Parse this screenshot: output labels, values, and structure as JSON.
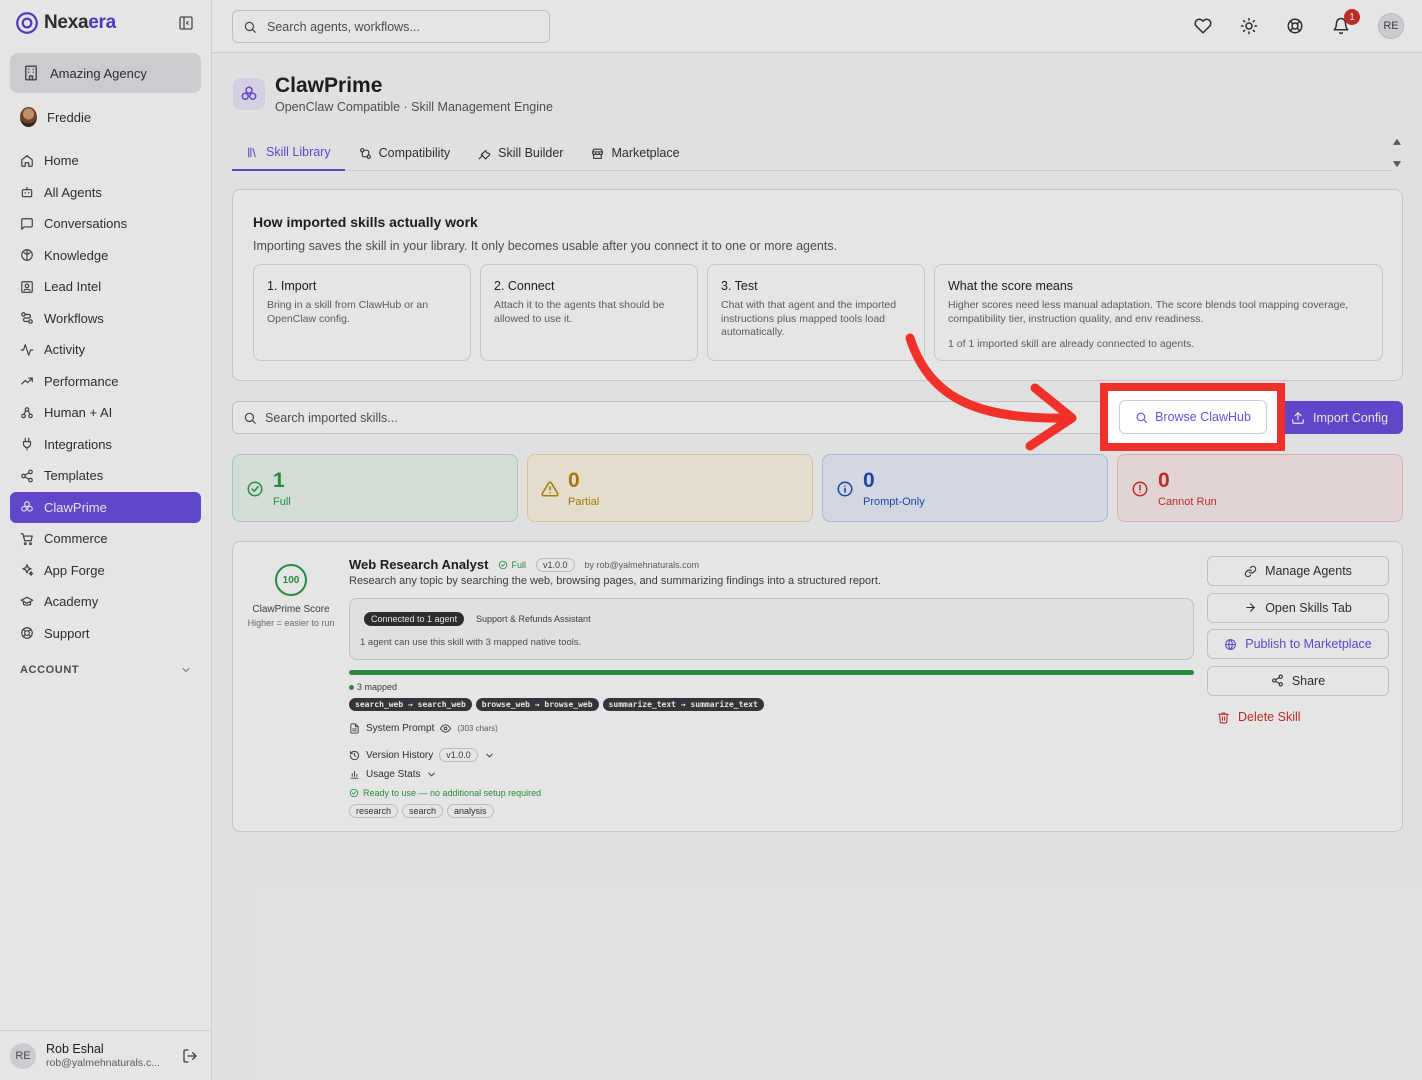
{
  "brand": {
    "name_prefix": "Nexa",
    "name_suffix": "era"
  },
  "agency": {
    "label": "Amazing Agency"
  },
  "user": {
    "name": "Freddie"
  },
  "nav": [
    {
      "label": "Home",
      "icon": "home-icon"
    },
    {
      "label": "All Agents",
      "icon": "bot-icon"
    },
    {
      "label": "Conversations",
      "icon": "message-icon"
    },
    {
      "label": "Knowledge",
      "icon": "brain-icon"
    },
    {
      "label": "Lead Intel",
      "icon": "contact-icon"
    },
    {
      "label": "Workflows",
      "icon": "workflow-icon"
    },
    {
      "label": "Activity",
      "icon": "activity-icon"
    },
    {
      "label": "Performance",
      "icon": "trend-icon"
    },
    {
      "label": "Human + AI",
      "icon": "users-icon"
    },
    {
      "label": "Integrations",
      "icon": "plug-icon"
    },
    {
      "label": "Templates",
      "icon": "share-icon"
    },
    {
      "label": "ClawPrime",
      "icon": "clawprime-icon",
      "active": true
    },
    {
      "label": "Commerce",
      "icon": "cart-icon"
    },
    {
      "label": "App Forge",
      "icon": "sparkle-icon"
    },
    {
      "label": "Academy",
      "icon": "graduation-icon"
    },
    {
      "label": "Support",
      "icon": "lifebuoy-icon"
    }
  ],
  "account_label": "ACCOUNT",
  "footer_user": {
    "initials": "RE",
    "name": "Rob Eshal",
    "email": "rob@yalmehnaturals.c..."
  },
  "topbar": {
    "search_placeholder": "Search agents, workflows...",
    "notification_count": "1",
    "avatar_initials": "RE"
  },
  "page": {
    "title": "ClawPrime",
    "subtitle": "OpenClaw Compatible · Skill Management Engine"
  },
  "tabs": [
    {
      "label": "Skill Library",
      "icon": "library-icon",
      "active": true
    },
    {
      "label": "Compatibility",
      "icon": "git-compare-icon"
    },
    {
      "label": "Skill Builder",
      "icon": "wrench-icon"
    },
    {
      "label": "Marketplace",
      "icon": "store-icon"
    }
  ],
  "info": {
    "title": "How imported skills actually work",
    "desc": "Importing saves the skill in your library. It only becomes usable after you connect it to one or more agents.",
    "steps": [
      {
        "title": "1. Import",
        "text": "Bring in a skill from ClawHub or an OpenClaw config."
      },
      {
        "title": "2. Connect",
        "text": "Attach it to the agents that should be allowed to use it."
      },
      {
        "title": "3. Test",
        "text": "Chat with that agent and the imported instructions plus mapped tools load automatically."
      }
    ],
    "score": {
      "title": "What the score means",
      "text": "Higher scores need less manual adaptation. The score blends tool mapping coverage, compatibility tier, instruction quality, and env readiness.",
      "note": "1 of 1 imported skill are already connected to agents."
    }
  },
  "library": {
    "search_placeholder": "Search imported skills...",
    "browse_label": "Browse ClawHub",
    "import_label": "Import Config"
  },
  "stats": [
    {
      "value": "1",
      "label": "Full"
    },
    {
      "value": "0",
      "label": "Partial"
    },
    {
      "value": "0",
      "label": "Prompt-Only"
    },
    {
      "value": "0",
      "label": "Cannot Run"
    }
  ],
  "colors": {
    "accent": "#6d4fe0",
    "success": "#2e9b4a",
    "warning": "#b8860b",
    "info": "#1e4fb8",
    "danger": "#d32f2f",
    "highlight": "#f0312a"
  },
  "skill": {
    "score": "100",
    "score_label": "ClawPrime Score",
    "score_sub": "Higher = easier to run",
    "name": "Web Research Analyst",
    "tier": "Full",
    "version": "v1.0.0",
    "author": "by rob@yalmehnaturals.com",
    "desc": "Research any topic by searching the web, browsing pages, and summarizing findings into a structured report.",
    "connected_label": "Connected to 1 agent",
    "connected_agent": "Support & Refunds Assistant",
    "connected_text": "1 agent can use this skill with 3 mapped native tools.",
    "mapping_progress": 1.0,
    "mapped_label": "3 mapped",
    "mappings": [
      "search_web → search_web",
      "browse_web → browse_web",
      "summarize_text → summarize_text"
    ],
    "system_prompt_label": "System Prompt",
    "system_prompt_chars": "(303 chars)",
    "version_history_label": "Version History",
    "version_history_value": "v1.0.0",
    "usage_label": "Usage Stats",
    "ready_text": "Ready to use — no additional setup required",
    "tags": [
      "research",
      "search",
      "analysis"
    ],
    "actions": {
      "manage": "Manage Agents",
      "open": "Open Skills Tab",
      "publish": "Publish to Marketplace",
      "share": "Share",
      "delete": "Delete Skill"
    }
  }
}
